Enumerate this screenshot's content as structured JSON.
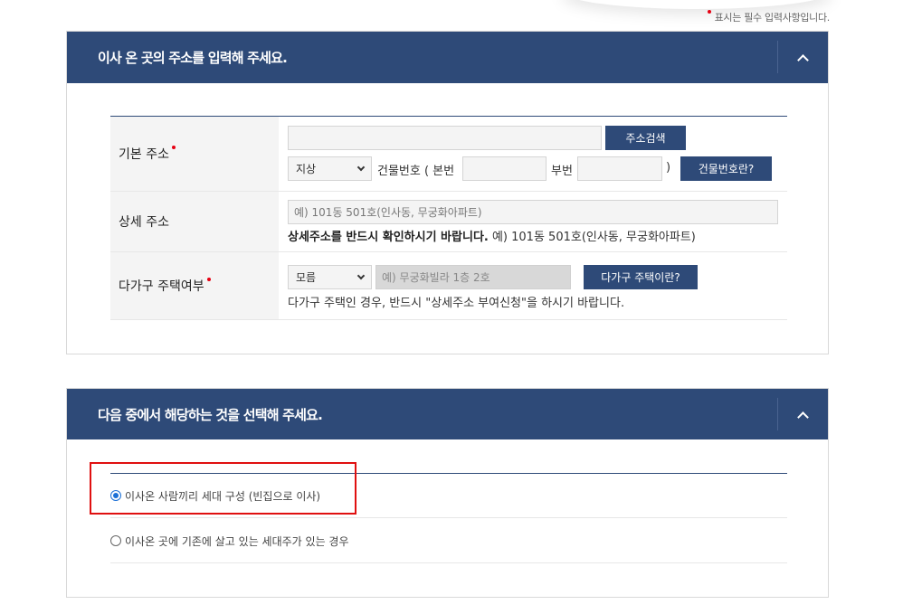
{
  "required_note": "표시는 필수 입력사항입니다.",
  "address_panel": {
    "title": "이사 온 곳의 주소를 입력해 주세요.",
    "basic_address": {
      "label": "기본 주소",
      "address_value": "",
      "search_button": "주소검색",
      "land_type": "지상",
      "building_no_label": "건물번호 ( 본번",
      "main_no_value": "",
      "sub_no_label": "부번",
      "sub_no_value": "",
      "close_paren": ")",
      "building_no_help_button": "건물번호란?"
    },
    "detail_address": {
      "label": "상세 주소",
      "placeholder": "예) 101동 501호(인사동, 무궁화아파트)",
      "note_bold": "상세주소를 반드시 확인하시기 바랍니다.",
      "note_rest": " 예) 101동 501호(인사동, 무궁화아파트)"
    },
    "multi_household": {
      "label": "다가구 주택여부",
      "select_value": "모름",
      "placeholder": "예) 무궁화빌라 1층 2호",
      "help_button": "다가구 주택이란?",
      "note": "다가구 주택인 경우, 반드시 \"상세주소 부여신청\"을 하시기 바랍니다."
    }
  },
  "choice_panel": {
    "title": "다음 중에서 해당하는 것을 선택해 주세요.",
    "options": [
      {
        "label": "이사온 사람끼리 세대 구성 (빈집으로 이사)",
        "selected": true
      },
      {
        "label": "이사온 곳에 기존에 살고 있는 세대주가 있는 경우",
        "selected": false
      }
    ]
  },
  "colors": {
    "header": "#2e4a78",
    "required_dot": "#e60012",
    "highlight": "#e01010"
  }
}
